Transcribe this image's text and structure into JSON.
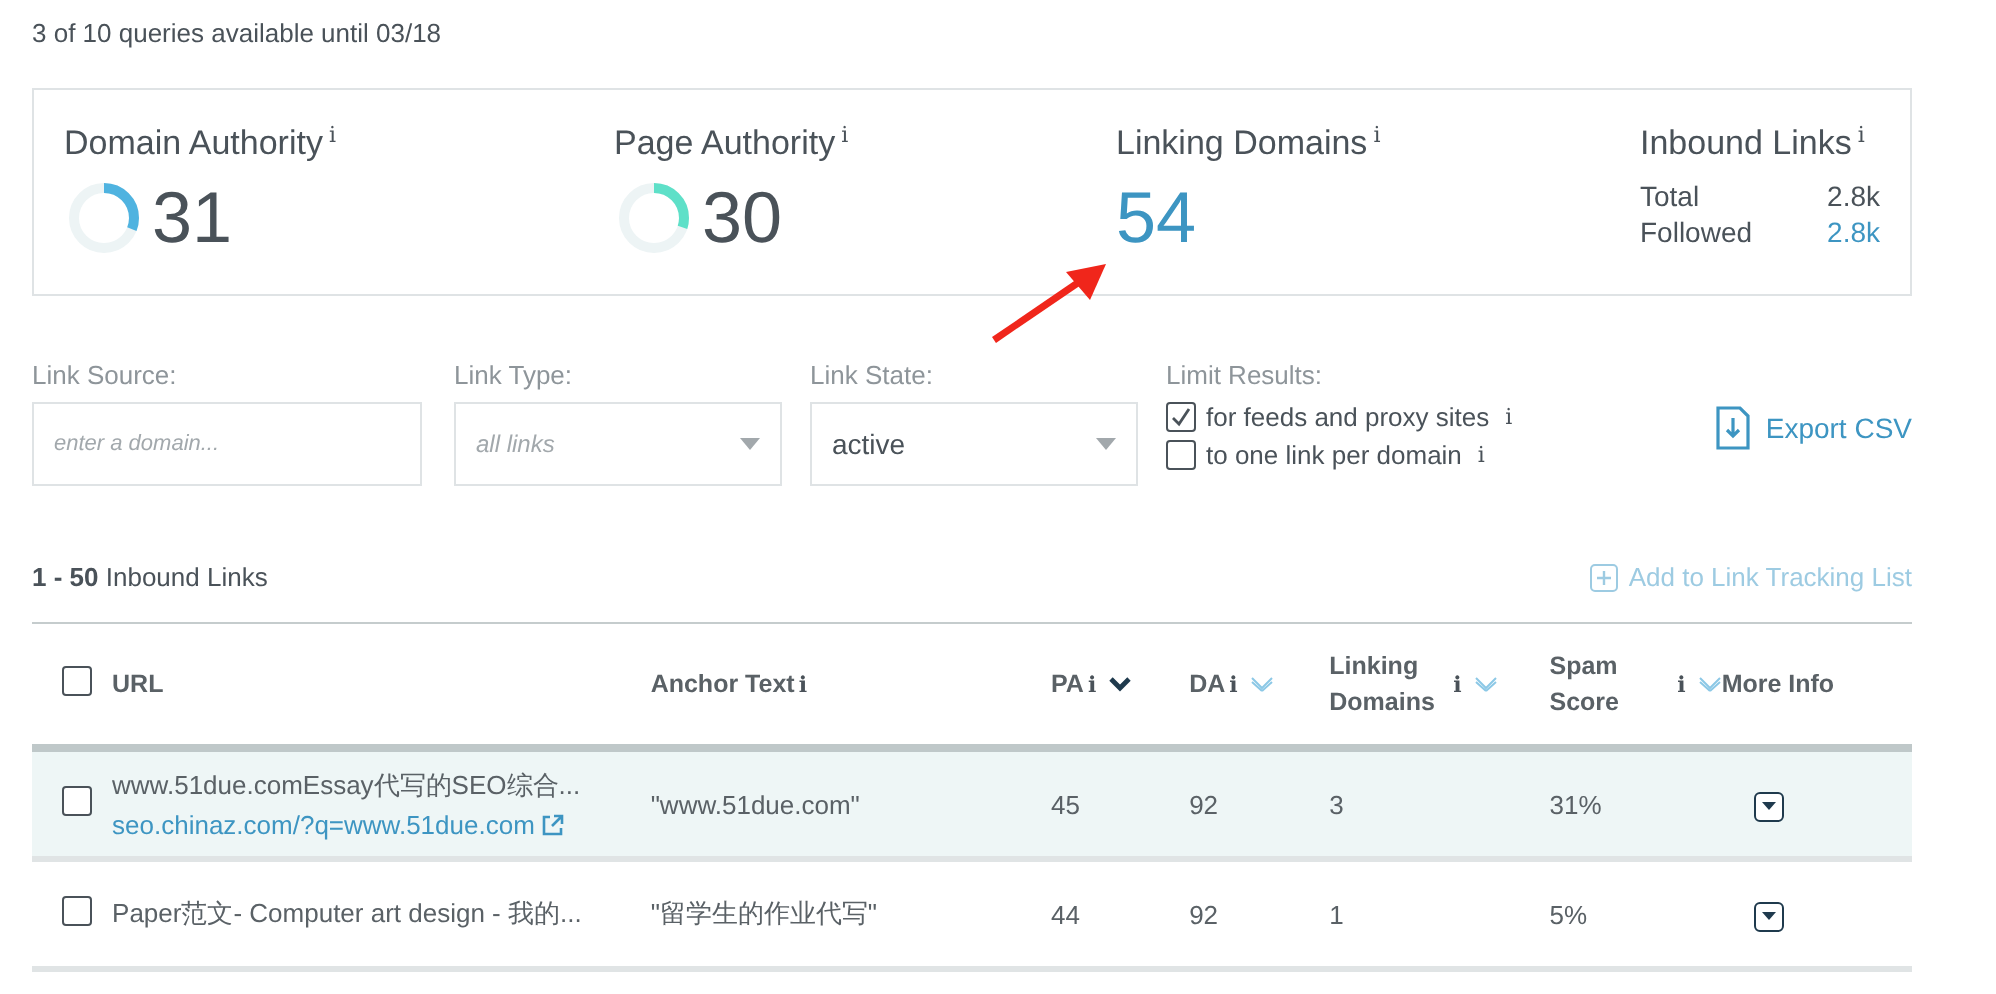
{
  "quota_text": "3 of 10 queries available until 03/18",
  "metrics": [
    {
      "kind": "gauge",
      "label": "Domain Authority",
      "info": "i",
      "value": "31",
      "level": 0.31,
      "color": "#4fb3e0"
    },
    {
      "kind": "gauge",
      "label": "Page Authority",
      "info": "i",
      "value": "30",
      "level": 0.3,
      "color": "#5ee0c8"
    },
    {
      "kind": "number",
      "label": "Linking Domains",
      "info": "i",
      "value": "54"
    },
    {
      "kind": "breakdown",
      "label": "Inbound Links",
      "info": "i",
      "rows": [
        {
          "name": "Total",
          "value": "2.8k",
          "link": false
        },
        {
          "name": "Followed",
          "value": "2.8k",
          "link": true
        }
      ]
    }
  ],
  "filters": [
    {
      "kind": "text",
      "label": "Link Source:",
      "placeholder": "enter a domain..."
    },
    {
      "kind": "select",
      "label": "Link Type:",
      "placeholder": "all links"
    },
    {
      "kind": "select",
      "label": "Link State:",
      "value": "active"
    }
  ],
  "limit_results": {
    "label": "Limit Results:",
    "options": [
      {
        "label": "for feeds and proxy sites",
        "info": "i",
        "checked": true
      },
      {
        "label": "to one link per domain",
        "info": "i",
        "checked": false
      }
    ]
  },
  "export_button": "Export CSV",
  "results": {
    "range": "1 - 50",
    "label": "Inbound Links",
    "add_button": "Add to Link Tracking List"
  },
  "table": {
    "select_all": {
      "checked": false
    },
    "columns": [
      {
        "label": "URL"
      },
      {
        "label": "Anchor Text",
        "info": "i"
      },
      {
        "label": "PA",
        "info": "i",
        "sortable": true,
        "selected": true
      },
      {
        "label": "DA",
        "info": "i",
        "sortable": true,
        "selected": false
      },
      {
        "label": "Linking Domains",
        "info": "i",
        "sortable": true,
        "selected": false
      },
      {
        "label": "Spam Score",
        "info": "i",
        "sortable": true,
        "selected": false
      },
      {
        "label": "More Info"
      }
    ],
    "rows": [
      {
        "selected": true,
        "checked": false,
        "title": "www.51due.comEssay代写的SEO综合...",
        "url": "seo.chinaz.com/?q=www.51due.com",
        "anchor": "\"www.51due.com\"",
        "pa": "45",
        "da": "92",
        "linking_domains": "3",
        "spam_score": "31%"
      },
      {
        "selected": false,
        "checked": false,
        "title": "Paper范文- Computer art design - 我的...",
        "anchor": "\"留学生的作业代写\"",
        "pa": "44",
        "da": "92",
        "linking_domains": "1",
        "spam_score": "5%"
      }
    ]
  }
}
